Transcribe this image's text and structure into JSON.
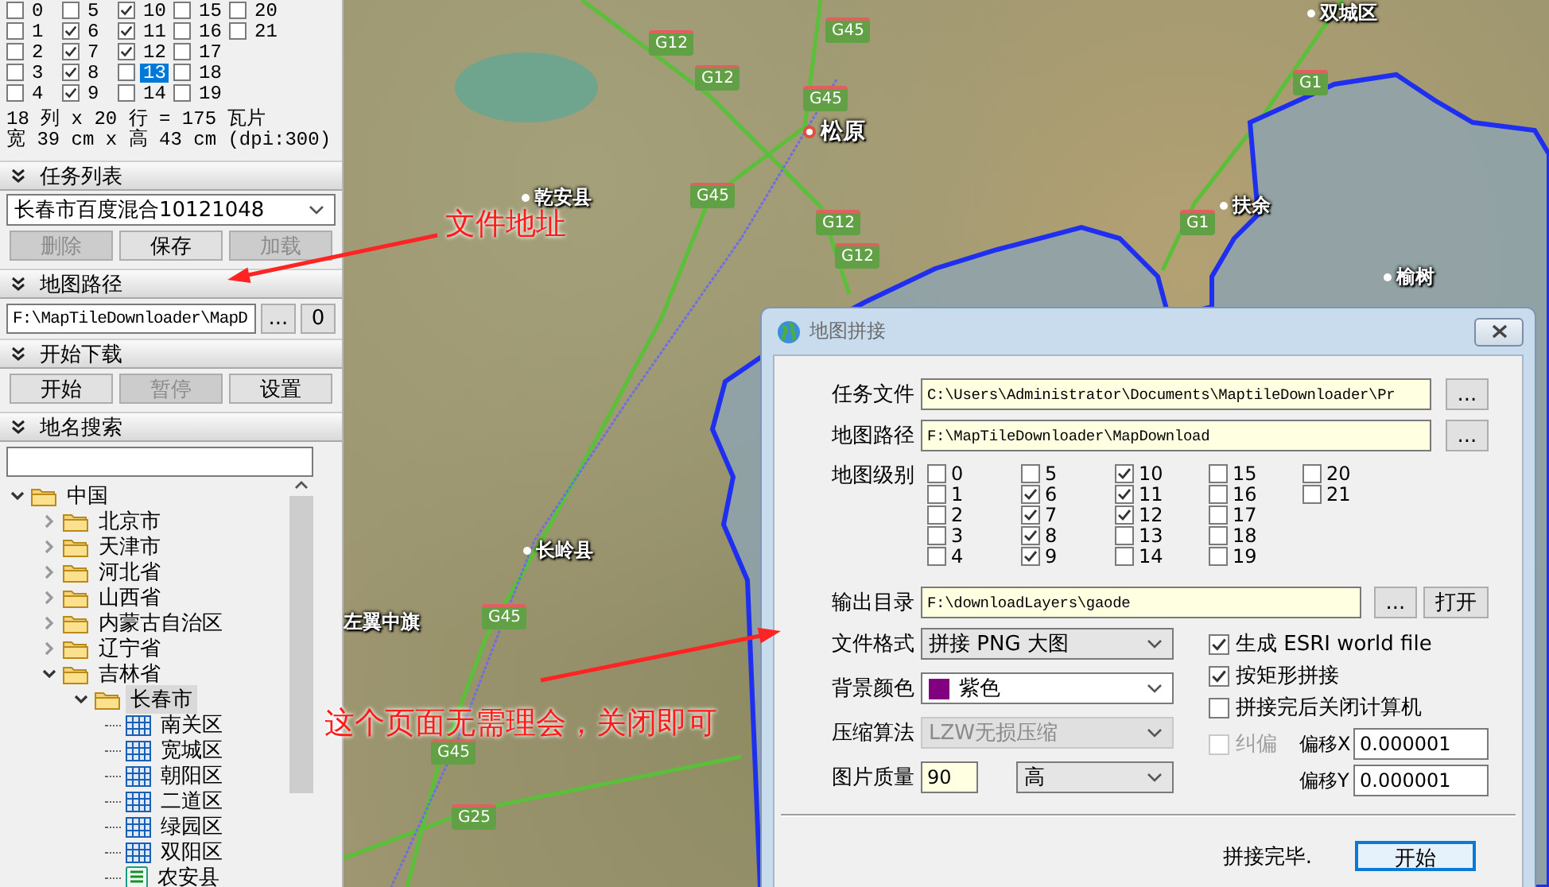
{
  "sidebar": {
    "levels": [
      {
        "label": "0",
        "checked": false,
        "selected": false
      },
      {
        "label": "1",
        "checked": false,
        "selected": false
      },
      {
        "label": "2",
        "checked": false,
        "selected": false
      },
      {
        "label": "3",
        "checked": false,
        "selected": false
      },
      {
        "label": "4",
        "checked": false,
        "selected": false
      },
      {
        "label": "5",
        "checked": false,
        "selected": false
      },
      {
        "label": "6",
        "checked": true,
        "selected": false
      },
      {
        "label": "7",
        "checked": true,
        "selected": false
      },
      {
        "label": "8",
        "checked": true,
        "selected": false
      },
      {
        "label": "9",
        "checked": true,
        "selected": false
      },
      {
        "label": "10",
        "checked": true,
        "selected": false
      },
      {
        "label": "11",
        "checked": true,
        "selected": false
      },
      {
        "label": "12",
        "checked": true,
        "selected": false
      },
      {
        "label": "13",
        "checked": false,
        "selected": true
      },
      {
        "label": "14",
        "checked": false,
        "selected": false
      },
      {
        "label": "15",
        "checked": false,
        "selected": false
      },
      {
        "label": "16",
        "checked": false,
        "selected": false
      },
      {
        "label": "17",
        "checked": false,
        "selected": false
      },
      {
        "label": "18",
        "checked": false,
        "selected": false
      },
      {
        "label": "19",
        "checked": false,
        "selected": false
      },
      {
        "label": "20",
        "checked": false,
        "selected": false
      },
      {
        "label": "21",
        "checked": false,
        "selected": false
      }
    ],
    "summary": [
      "18 列 x 20 行 = 175 瓦片",
      "宽 39 cm x 高 43 cm (dpi:300)"
    ],
    "task_list": {
      "header": "任务列表",
      "value": "长春市百度混合10121048",
      "buttons": [
        {
          "label": "删除",
          "disabled": true
        },
        {
          "label": "保存",
          "disabled": false
        },
        {
          "label": "加载",
          "disabled": true
        }
      ]
    },
    "map_path": {
      "header": "地图路径",
      "value": "F:\\MapTileDownloader\\MapD",
      "buttons": [
        {
          "label": "..."
        },
        {
          "label": "0"
        }
      ]
    },
    "download": {
      "header": "开始下载",
      "buttons": [
        {
          "label": "开始",
          "disabled": false
        },
        {
          "label": "暂停",
          "disabled": true
        },
        {
          "label": "设置",
          "disabled": false
        }
      ]
    },
    "place_search": {
      "header": "地名搜索",
      "tree": [
        {
          "label": "中国",
          "kind": "folder",
          "expanded": true,
          "selected": false,
          "children": [
            {
              "label": "北京市",
              "kind": "folder",
              "expanded": false,
              "selected": false
            },
            {
              "label": "天津市",
              "kind": "folder",
              "expanded": false,
              "selected": false
            },
            {
              "label": "河北省",
              "kind": "folder",
              "expanded": false,
              "selected": false
            },
            {
              "label": "山西省",
              "kind": "folder",
              "expanded": false,
              "selected": false
            },
            {
              "label": "内蒙古自治区",
              "kind": "folder",
              "expanded": false,
              "selected": false
            },
            {
              "label": "辽宁省",
              "kind": "folder",
              "expanded": false,
              "selected": false
            },
            {
              "label": "吉林省",
              "kind": "folder",
              "expanded": true,
              "selected": false,
              "children": [
                {
                  "label": "长春市",
                  "kind": "folder",
                  "expanded": true,
                  "selected": true,
                  "children": [
                    {
                      "label": "南关区",
                      "kind": "district",
                      "selected": false
                    },
                    {
                      "label": "宽城区",
                      "kind": "district",
                      "selected": false
                    },
                    {
                      "label": "朝阳区",
                      "kind": "district",
                      "selected": false
                    },
                    {
                      "label": "二道区",
                      "kind": "district",
                      "selected": false
                    },
                    {
                      "label": "绿园区",
                      "kind": "district",
                      "selected": false
                    },
                    {
                      "label": "双阳区",
                      "kind": "district",
                      "selected": false
                    },
                    {
                      "label": "农安县",
                      "kind": "county",
                      "selected": false
                    }
                  ]
                }
              ]
            }
          ]
        }
      ]
    }
  },
  "map": {
    "labels": [
      {
        "text": "双城区",
        "kind": "town"
      },
      {
        "text": "松原",
        "kind": "city"
      },
      {
        "text": "乾安县",
        "kind": "town"
      },
      {
        "text": "扶余",
        "kind": "town"
      },
      {
        "text": "榆树",
        "kind": "town"
      },
      {
        "text": "长岭县",
        "kind": "town"
      },
      {
        "text": "左翼中旗",
        "kind": "label"
      }
    ],
    "shields": [
      "G45",
      "G12",
      "G12",
      "G45",
      "G45",
      "G12",
      "G12",
      "G1",
      "G1",
      "G45",
      "G45",
      "G25"
    ]
  },
  "annotations": [
    {
      "text": "文件地址"
    },
    {
      "text": "这个页面无需理会，关闭即可"
    }
  ],
  "dialog": {
    "title": "地图拼接",
    "fields": [
      {
        "label": "任务文件",
        "value": "C:\\Users\\Administrator\\Documents\\MaptileDownloader\\Pr",
        "button": "..."
      },
      {
        "label": "地图路径",
        "value": "F:\\MapTileDownloader\\MapDownload",
        "button": "..."
      }
    ],
    "levels_label": "地图级别",
    "levels": [
      {
        "label": "0",
        "checked": false
      },
      {
        "label": "1",
        "checked": false
      },
      {
        "label": "2",
        "checked": false
      },
      {
        "label": "3",
        "checked": false
      },
      {
        "label": "4",
        "checked": false
      },
      {
        "label": "5",
        "checked": false
      },
      {
        "label": "6",
        "checked": true
      },
      {
        "label": "7",
        "checked": true
      },
      {
        "label": "8",
        "checked": true
      },
      {
        "label": "9",
        "checked": true
      },
      {
        "label": "10",
        "checked": true
      },
      {
        "label": "11",
        "checked": true
      },
      {
        "label": "12",
        "checked": true
      },
      {
        "label": "13",
        "checked": false
      },
      {
        "label": "14",
        "checked": false
      },
      {
        "label": "15",
        "checked": false
      },
      {
        "label": "16",
        "checked": false
      },
      {
        "label": "17",
        "checked": false
      },
      {
        "label": "18",
        "checked": false
      },
      {
        "label": "19",
        "checked": false
      },
      {
        "label": "20",
        "checked": false
      },
      {
        "label": "21",
        "checked": false
      }
    ],
    "output": {
      "label": "输出目录",
      "value": "F:\\downloadLayers\\gaode",
      "buttons": [
        "...",
        "打开"
      ]
    },
    "format": {
      "label": "文件格式",
      "value": "拼接 PNG 大图"
    },
    "background": {
      "label": "背景颜色",
      "value": "紫色",
      "color": "#800080"
    },
    "compression": {
      "label": "压缩算法",
      "value": "LZW无损压缩",
      "disabled": true
    },
    "quality": {
      "label": "图片质量",
      "value": "90",
      "grade": "高"
    },
    "options": [
      {
        "label": "生成 ESRI world file",
        "checked": true
      },
      {
        "label": "按矩形拼接",
        "checked": true
      },
      {
        "label": "拼接完后关闭计算机",
        "checked": false
      }
    ],
    "correction": {
      "label": "纠偏",
      "checked": false,
      "disabled": true
    },
    "offsets": [
      {
        "label": "偏移X",
        "value": "0.000001"
      },
      {
        "label": "偏移Y",
        "value": "0.000001"
      }
    ],
    "status": "拼接完毕.",
    "start_button": "开始"
  }
}
